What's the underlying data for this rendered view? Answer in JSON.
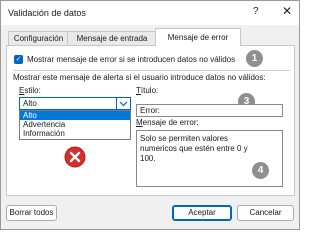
{
  "window": {
    "title": "Validación de datos",
    "help_glyph": "?",
    "close_glyph": "✕"
  },
  "tabs": [
    {
      "label": "Configuración"
    },
    {
      "label": "Mensaje de entrada"
    },
    {
      "label": "Mensaje de error",
      "active": true
    }
  ],
  "error_tab": {
    "show_error_checkbox": {
      "checked": true,
      "label": "Mostrar mensaje de error si se introducen datos no válidos"
    },
    "section_label": "Mostrar este mensaje de alerta si el usuario introduce datos no válidos:",
    "style": {
      "label": "Estilo:",
      "value": "Alto",
      "options": [
        "Alto",
        "Advertencia",
        "Información"
      ],
      "selected_index": 0
    },
    "title": {
      "label": "Título:",
      "value": "Error:"
    },
    "message": {
      "label": "Mensaje de error:",
      "value": "Solo se permiten valores numericos que estén entre 0 y 100."
    }
  },
  "badges": [
    "1",
    "2",
    "3",
    "4"
  ],
  "icons": {
    "error_icon": "error-circle-icon",
    "dropdown_arrow": "chevron-down-icon"
  },
  "buttons": {
    "clear_all": "Borrar todos",
    "accept": "Aceptar",
    "cancel": "Cancelar"
  },
  "colors": {
    "accent": "#0067c0",
    "error_red": "#d32f2f",
    "selection": "#0078d7",
    "badge": "#8f8f8f"
  }
}
